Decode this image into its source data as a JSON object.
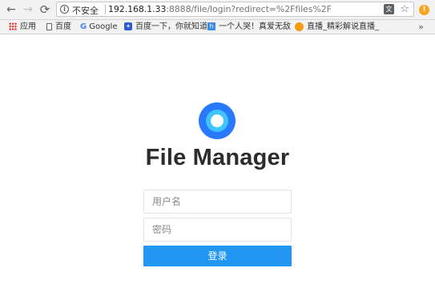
{
  "browser": {
    "security_label": "不安全",
    "url_host": "192.168.1.33",
    "url_rest": ":8888/file/login?redirect=%2Ffiles%2F",
    "bookmarks": [
      {
        "label": "应用",
        "icon": "apps-grid-icon"
      },
      {
        "label": "百度",
        "icon": "page-icon"
      },
      {
        "label": "Google",
        "icon": "google-icon"
      },
      {
        "label": "百度一下，你就知道",
        "icon": "baidu-paw-icon"
      },
      {
        "label": "一个人哭！真爱无敌",
        "icon": "site-icon"
      },
      {
        "label": "直播_精彩解说直播_",
        "icon": "site-icon"
      }
    ],
    "more_label": "»"
  },
  "page": {
    "app_title": "File Manager",
    "username_placeholder": "用户名",
    "password_placeholder": "密码",
    "login_label": "登录",
    "accent_color": "#2196f3"
  }
}
